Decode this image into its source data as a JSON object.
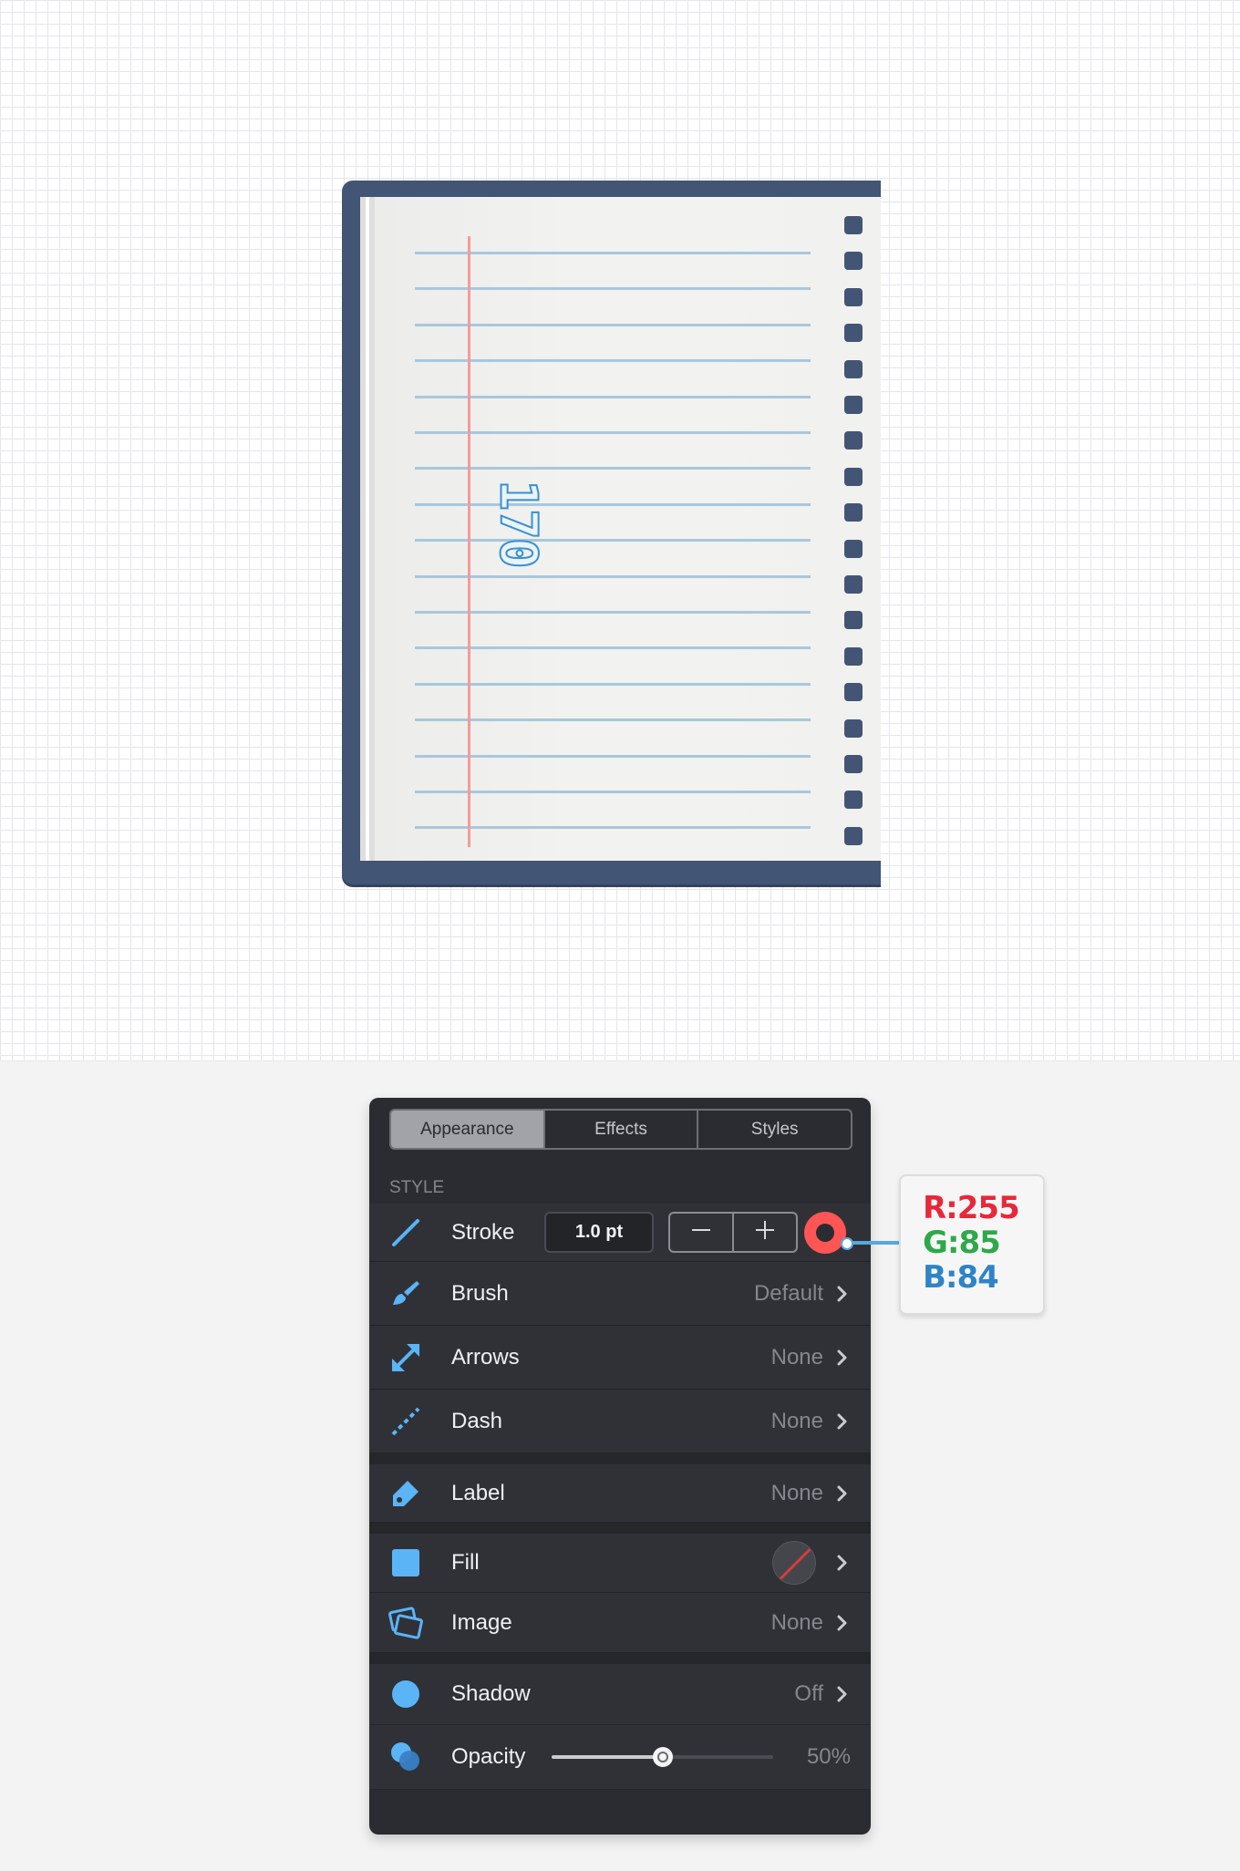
{
  "notebook": {
    "page_number": "170",
    "ruled_line_count": 17,
    "ring_hole_count": 18,
    "colors": {
      "cover": "#435575",
      "rule": "#a9c7dc",
      "margin": "#f39b9b",
      "number": "#3a90cf"
    }
  },
  "panel": {
    "tabs": [
      {
        "label": "Appearance",
        "active": true
      },
      {
        "label": "Effects",
        "active": false
      },
      {
        "label": "Styles",
        "active": false
      }
    ],
    "section_title": "STYLE",
    "stroke": {
      "label": "Stroke",
      "width_value": "1.0 pt",
      "decrement_icon": "minus-icon",
      "increment_icon": "plus-icon",
      "color": "#ff5554"
    },
    "brush": {
      "label": "Brush",
      "value": "Default"
    },
    "arrows": {
      "label": "Arrows",
      "value": "None"
    },
    "dash": {
      "label": "Dash",
      "value": "None"
    },
    "label_row": {
      "label": "Label",
      "value": "None"
    },
    "fill": {
      "label": "Fill",
      "value": "none-swatch"
    },
    "image": {
      "label": "Image",
      "value": "None"
    },
    "shadow": {
      "label": "Shadow",
      "value": "Off"
    },
    "opacity": {
      "label": "Opacity",
      "value": "50%",
      "level": 0.5
    },
    "accent_color": "#5ab4f6"
  },
  "color_callout": {
    "r": "R:255",
    "g": "G:85",
    "b": "B:84",
    "colors": {
      "r": "#e8283a",
      "g": "#2ea84a",
      "b": "#2f84c6"
    }
  }
}
